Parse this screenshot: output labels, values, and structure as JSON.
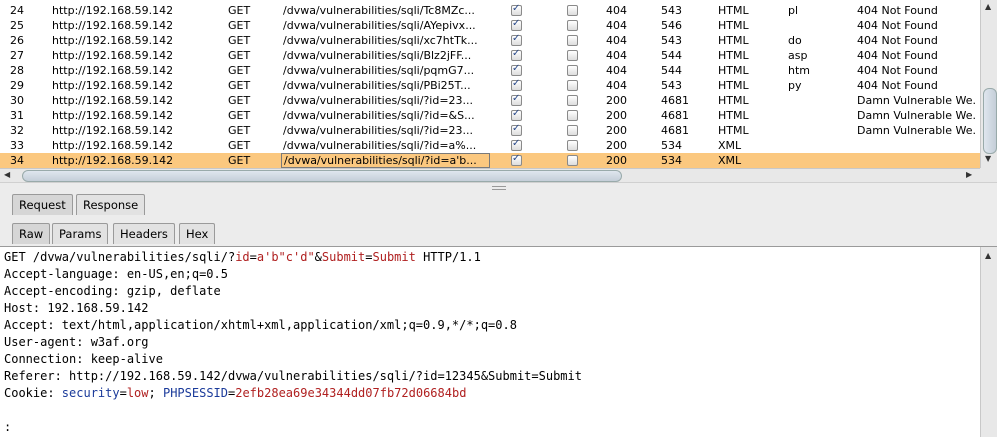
{
  "rows": [
    {
      "id": "24",
      "host": "http://192.168.59.142",
      "method": "GET",
      "url": "/dvwa/vulnerabilities/sqli/Tc8MZc...",
      "params": true,
      "edited": false,
      "status": "404",
      "length": "543",
      "mime": "HTML",
      "ext": "pl",
      "title": "404 Not Found"
    },
    {
      "id": "25",
      "host": "http://192.168.59.142",
      "method": "GET",
      "url": "/dvwa/vulnerabilities/sqli/AYepivx...",
      "params": true,
      "edited": false,
      "status": "404",
      "length": "546",
      "mime": "HTML",
      "ext": "",
      "title": "404 Not Found"
    },
    {
      "id": "26",
      "host": "http://192.168.59.142",
      "method": "GET",
      "url": "/dvwa/vulnerabilities/sqli/xc7htTk...",
      "params": true,
      "edited": false,
      "status": "404",
      "length": "543",
      "mime": "HTML",
      "ext": "do",
      "title": "404 Not Found"
    },
    {
      "id": "27",
      "host": "http://192.168.59.142",
      "method": "GET",
      "url": "/dvwa/vulnerabilities/sqli/Blz2jFF...",
      "params": true,
      "edited": false,
      "status": "404",
      "length": "544",
      "mime": "HTML",
      "ext": "asp",
      "title": "404 Not Found"
    },
    {
      "id": "28",
      "host": "http://192.168.59.142",
      "method": "GET",
      "url": "/dvwa/vulnerabilities/sqli/pqmG7...",
      "params": true,
      "edited": false,
      "status": "404",
      "length": "544",
      "mime": "HTML",
      "ext": "htm",
      "title": "404 Not Found"
    },
    {
      "id": "29",
      "host": "http://192.168.59.142",
      "method": "GET",
      "url": "/dvwa/vulnerabilities/sqli/PBi25T...",
      "params": true,
      "edited": false,
      "status": "404",
      "length": "543",
      "mime": "HTML",
      "ext": "py",
      "title": "404 Not Found"
    },
    {
      "id": "30",
      "host": "http://192.168.59.142",
      "method": "GET",
      "url": "/dvwa/vulnerabilities/sqli/?id=23...",
      "params": true,
      "edited": false,
      "status": "200",
      "length": "4681",
      "mime": "HTML",
      "ext": "",
      "title": "Damn Vulnerable We..."
    },
    {
      "id": "31",
      "host": "http://192.168.59.142",
      "method": "GET",
      "url": "/dvwa/vulnerabilities/sqli/?id=&S...",
      "params": true,
      "edited": false,
      "status": "200",
      "length": "4681",
      "mime": "HTML",
      "ext": "",
      "title": "Damn Vulnerable We..."
    },
    {
      "id": "32",
      "host": "http://192.168.59.142",
      "method": "GET",
      "url": "/dvwa/vulnerabilities/sqli/?id=23...",
      "params": true,
      "edited": false,
      "status": "200",
      "length": "4681",
      "mime": "HTML",
      "ext": "",
      "title": "Damn Vulnerable We..."
    },
    {
      "id": "33",
      "host": "http://192.168.59.142",
      "method": "GET",
      "url": "/dvwa/vulnerabilities/sqli/?id=a%...",
      "params": true,
      "edited": false,
      "status": "200",
      "length": "534",
      "mime": "XML",
      "ext": "",
      "title": ""
    },
    {
      "id": "34",
      "host": "http://192.168.59.142",
      "method": "GET",
      "url": "/dvwa/vulnerabilities/sqli/?id=a'b...",
      "params": true,
      "edited": false,
      "status": "200",
      "length": "534",
      "mime": "XML",
      "ext": "",
      "title": "",
      "selected": true
    }
  ],
  "top_tabs": [
    {
      "label": "Request",
      "active": true
    },
    {
      "label": "Response",
      "active": false
    }
  ],
  "sub_tabs": [
    {
      "label": "Raw",
      "active": true
    },
    {
      "label": "Params",
      "active": false
    },
    {
      "label": "Headers",
      "active": false
    },
    {
      "label": "Hex",
      "active": false
    }
  ],
  "request": {
    "line1": {
      "a": "GET /dvwa/vulnerabilities/sqli/?",
      "b": "id",
      "c": "=",
      "d": "a'b\"c'd\"",
      "e": "&",
      "f": "Submit",
      "g": "=",
      "h": "Submit",
      "i": " HTTP/1.1"
    },
    "headers": [
      "Accept-language: en-US,en;q=0.5",
      "Accept-encoding: gzip, deflate",
      "Host: 192.168.59.142",
      "Accept: text/html,application/xhtml+xml,application/xml;q=0.9,*/*;q=0.8",
      "User-agent: w3af.org",
      "Connection: keep-alive",
      "Referer: http://192.168.59.142/dvwa/vulnerabilities/sqli/?id=12345&Submit=Submit"
    ],
    "cookie": {
      "a": "Cookie: ",
      "b": "security",
      "c": "=",
      "d": "low",
      "e": "; ",
      "f": "PHPSESSID",
      "g": "=",
      "h": "2efb28ea69e34344dd07fb72d06684bd"
    },
    "cursor": ":"
  }
}
